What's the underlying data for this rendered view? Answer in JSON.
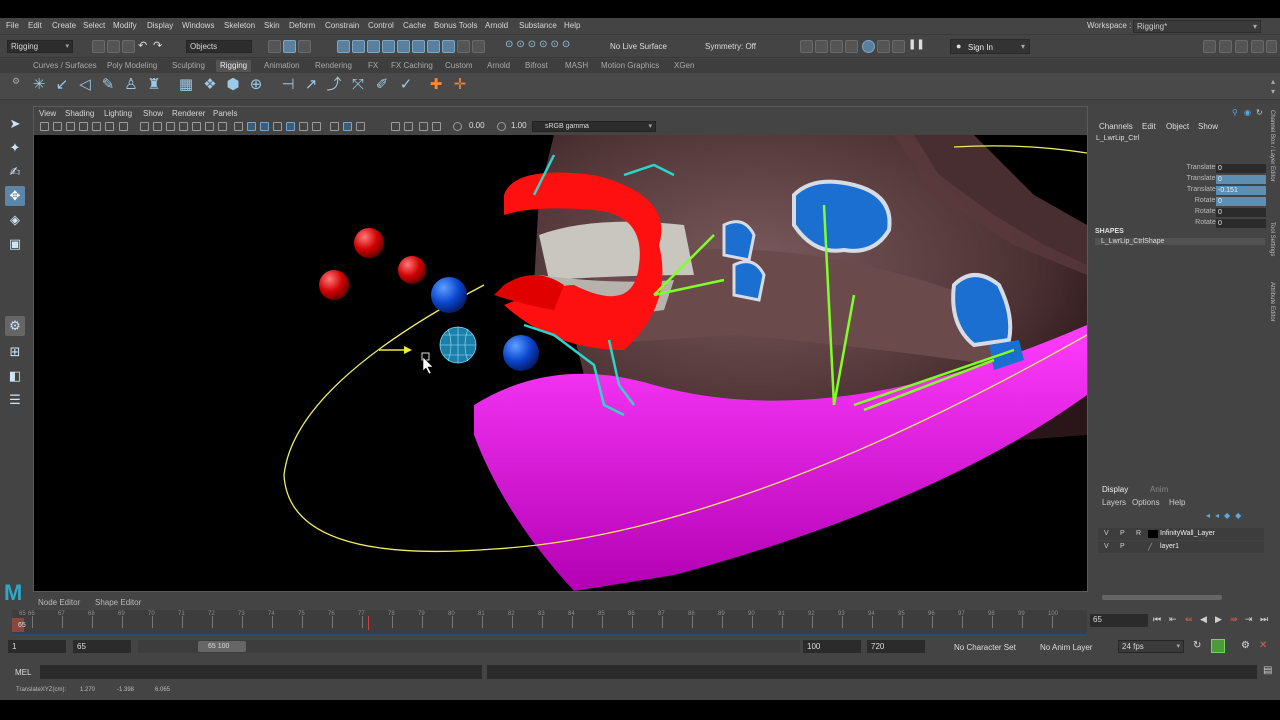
{
  "menu": [
    "File",
    "Edit",
    "Create",
    "Select",
    "Modify",
    "Display",
    "Windows",
    "Skeleton",
    "Skin",
    "Deform",
    "Constrain",
    "Control",
    "Cache",
    "Bonus Tools",
    "Arnold",
    "Substance",
    "Help"
  ],
  "workspace": {
    "label": "Workspace :",
    "value": "Rigging*"
  },
  "status": {
    "mode": "Rigging",
    "objects": "Objects",
    "live": "No Live Surface",
    "symmetry": "Symmetry: Off",
    "signin": "Sign In"
  },
  "shelf_tabs": [
    "Curves / Surfaces",
    "Poly Modeling",
    "Sculpting",
    "Rigging",
    "Animation",
    "Rendering",
    "FX",
    "FX Caching",
    "Custom",
    "Arnold",
    "Bifrost",
    "MASH",
    "Motion Graphics",
    "XGen"
  ],
  "viewport": {
    "menu": [
      "View",
      "Shading",
      "Lighting",
      "Show",
      "Renderer",
      "Panels"
    ],
    "exposure": "0.00",
    "gamma": "1.00",
    "colorspace": "sRGB gamma"
  },
  "channelbox": {
    "menu": [
      "Channels",
      "Edit",
      "Object",
      "Show"
    ],
    "object": "L_LwrLip_Ctrl",
    "channels": [
      {
        "name": "Translate X",
        "value": "0"
      },
      {
        "name": "Translate Y",
        "value": "0"
      },
      {
        "name": "Translate Z",
        "value": "-0.151"
      },
      {
        "name": "Rotate X",
        "value": "0"
      },
      {
        "name": "Rotate Y",
        "value": "0"
      },
      {
        "name": "Rotate Z",
        "value": "0"
      }
    ],
    "shapes_label": "SHAPES",
    "shape": "L_LwrLip_CtrlShape"
  },
  "layers": {
    "tabs": [
      "Display",
      "Anim"
    ],
    "menu": [
      "Layers",
      "Options",
      "Help"
    ],
    "rows": [
      {
        "v": "V",
        "p": "P",
        "r": "R",
        "name": "InfinityWall_Layer"
      },
      {
        "v": "V",
        "p": "P",
        "r": "",
        "name": "layer1"
      }
    ]
  },
  "side_tabs": [
    "Channel Box / Layer Editor",
    "Tool Settings",
    "Attribute Editor"
  ],
  "bottom_tabs": [
    "Node Editor",
    "Shape Editor"
  ],
  "timeline": {
    "start_label": "65",
    "ticks": [
      "66",
      "67",
      "68",
      "69",
      "70",
      "71",
      "72",
      "73",
      "74",
      "75",
      "76",
      "77",
      "78",
      "79",
      "80",
      "81",
      "82",
      "83",
      "84",
      "85",
      "86",
      "87",
      "88",
      "89",
      "90",
      "91",
      "92",
      "93",
      "94",
      "95",
      "96",
      "97",
      "98",
      "99",
      "100"
    ],
    "current": "65"
  },
  "range": {
    "start": "1",
    "anim_start": "65",
    "slider": "65  100",
    "end": "100",
    "anim_end": "720",
    "character": "No Character Set",
    "anim_layer": "No Anim Layer",
    "fps": "24 fps"
  },
  "mel": "MEL",
  "helpline": {
    "label": "TranslateXYZ(cm):",
    "x": "1.270",
    "y": "-1.398",
    "z": "6.065"
  },
  "colors": {
    "panel": "#444444",
    "accent": "#5c86a8",
    "magenta": "#ff00ff",
    "red": "#ff1010",
    "blue": "#1a6fd6"
  }
}
